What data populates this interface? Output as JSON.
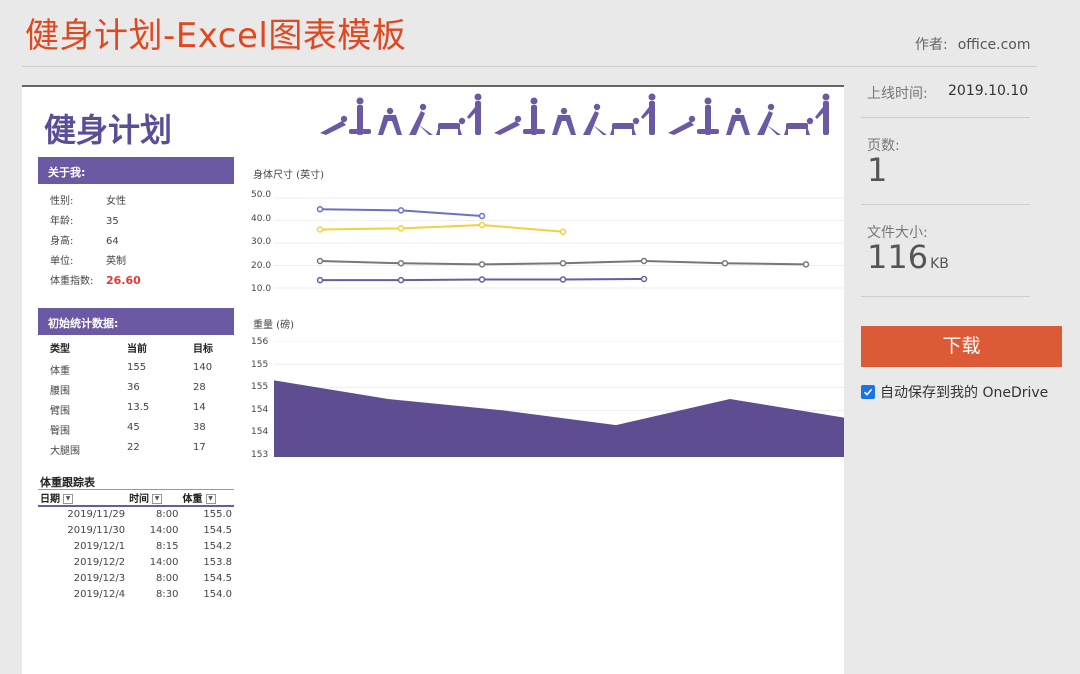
{
  "page": {
    "title": "健身计划-Excel图表模板",
    "author_label": "作者:",
    "author": "office.com"
  },
  "meta": {
    "published_label": "上线时间:",
    "published": "2019.10.10",
    "pages_label": "页数:",
    "pages": "1",
    "size_label": "文件大小:",
    "size": "116",
    "size_unit": "KB"
  },
  "download_label": "下载",
  "autosave_label": "自动保存到我的 OneDrive",
  "autosave_checked": true,
  "sheet": {
    "title": "健身计划",
    "silhouettes_icon": "exercise-silhouettes-icon",
    "accent": "#6b5aa3",
    "about": {
      "header": "关于我:",
      "rows": [
        {
          "k": "性别:",
          "v": "女性"
        },
        {
          "k": "年龄:",
          "v": "35"
        },
        {
          "k": "身高:",
          "v": "64"
        },
        {
          "k": "单位:",
          "v": "英制"
        },
        {
          "k": "体重指数:",
          "v": "26.60"
        }
      ]
    },
    "stats": {
      "header": "初始统计数据:",
      "cols": [
        "类型",
        "当前",
        "目标"
      ],
      "rows": [
        [
          "体重",
          "155",
          "140"
        ],
        [
          "腰围",
          "36",
          "28"
        ],
        [
          "臂围",
          "13.5",
          "14"
        ],
        [
          "臀围",
          "45",
          "38"
        ],
        [
          "大腿围",
          "22",
          "17"
        ]
      ]
    },
    "tracker": {
      "title": "体重跟踪表",
      "cols": [
        "日期",
        "时间",
        "体重"
      ],
      "rows": [
        [
          "2019/11/29",
          "8:00",
          "155.0"
        ],
        [
          "2019/11/30",
          "14:00",
          "154.5"
        ],
        [
          "2019/12/1",
          "8:15",
          "154.2"
        ],
        [
          "2019/12/2",
          "14:00",
          "153.8"
        ],
        [
          "2019/12/3",
          "8:00",
          "154.5"
        ],
        [
          "2019/12/4",
          "8:30",
          "154.0"
        ]
      ]
    }
  },
  "chart_data": [
    {
      "type": "line",
      "title": "身体尺寸 (英寸)",
      "y_ticks": [
        "50.0",
        "40.0",
        "30.0",
        "20.0",
        "10.0"
      ],
      "ylim": [
        10,
        50
      ],
      "x": [
        1,
        2,
        3,
        4,
        5,
        6,
        7
      ],
      "series": [
        {
          "color": "#6b72c4",
          "values": [
            45,
            44.5,
            42,
            null,
            null,
            null,
            null
          ]
        },
        {
          "color": "#f5d03b",
          "values": [
            36,
            36.5,
            38,
            35,
            null,
            null,
            null
          ]
        },
        {
          "color": "#777777",
          "values": [
            22,
            21,
            20.5,
            21,
            22,
            21,
            20.5
          ]
        },
        {
          "color": "#6b5aa3",
          "values": [
            13.5,
            13.5,
            13.8,
            13.8,
            14,
            null,
            null
          ]
        }
      ],
      "grid": true
    },
    {
      "type": "area",
      "title": "重量 (磅)",
      "y_ticks": [
        "156",
        "155",
        "155",
        "154",
        "154",
        "153"
      ],
      "ylim": [
        153,
        156
      ],
      "x": [
        "2019/11/29",
        "2019/11/30",
        "2019/12/1",
        "2019/12/2",
        "2019/12/3",
        "2019/12/4"
      ],
      "values": [
        155.0,
        154.5,
        154.2,
        153.8,
        154.5,
        154.0
      ],
      "color": "#5e4d91",
      "grid": true
    }
  ]
}
